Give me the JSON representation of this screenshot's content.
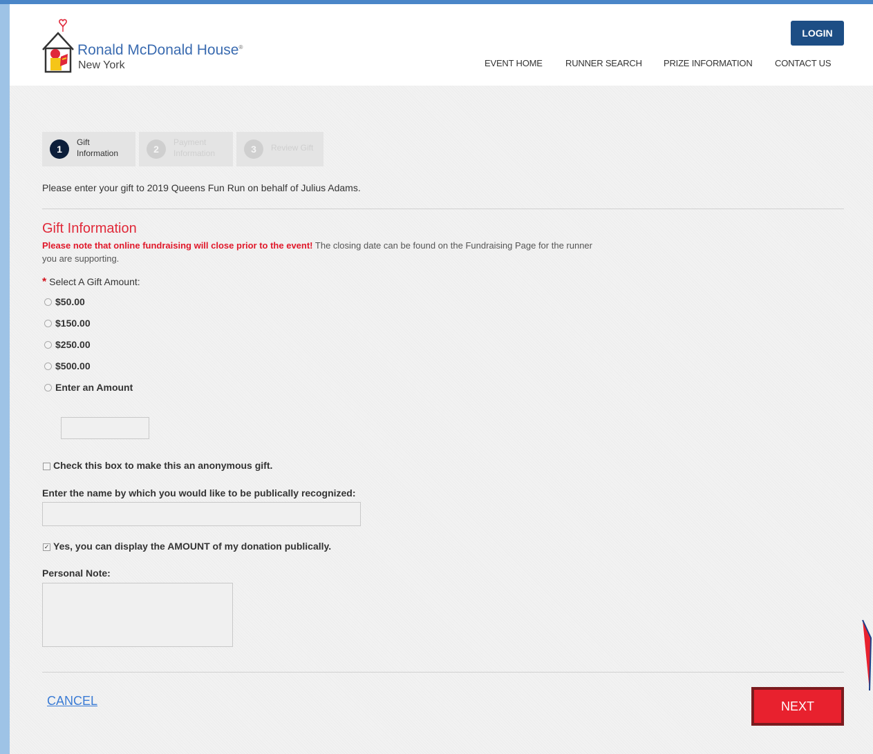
{
  "brand": {
    "name": "Ronald McDonald House",
    "registered_mark": "®",
    "location": "New York"
  },
  "header": {
    "login_label": "LOGIN",
    "nav": [
      "EVENT HOME",
      "RUNNER SEARCH",
      "PRIZE INFORMATION",
      "CONTACT US"
    ]
  },
  "steps": [
    {
      "number": "1",
      "label_line1": "Gift",
      "label_line2": "Information",
      "state": "active"
    },
    {
      "number": "2",
      "label_line1": "Payment",
      "label_line2": "Information",
      "state": "inactive"
    },
    {
      "number": "3",
      "label_line1": "Review Gift",
      "label_line2": "",
      "state": "inactive"
    }
  ],
  "intro_text": "Please enter your gift to 2019 Queens Fun Run on behalf of Julius Adams.",
  "gift_section": {
    "title": "Gift Information",
    "notice_bold": "Please note that online fundraising will close prior to the event!",
    "notice_rest": " The closing date can be found on the Fundraising Page for the runner you are supporting.",
    "required_marker": "*",
    "amount_label": "Select A Gift Amount:",
    "amount_options": [
      "$50.00",
      "$150.00",
      "$250.00",
      "$500.00",
      "Enter an Amount"
    ],
    "custom_amount_value": ""
  },
  "anonymous": {
    "label": "Check this box to make this an anonymous gift.",
    "checked": false
  },
  "recognition": {
    "label": "Enter the name by which you would like to be publically recognized:",
    "value": ""
  },
  "display_amount": {
    "label": "Yes, you can display the AMOUNT of my donation publically.",
    "checked": true
  },
  "personal_note": {
    "label": "Personal Note:",
    "value": ""
  },
  "actions": {
    "cancel_label": "CANCEL",
    "next_label": "NEXT"
  },
  "colors": {
    "accent_red": "#e8212e",
    "heading_red": "#e02838",
    "nav_blue": "#1d4e85",
    "link_blue": "#3a7bd5",
    "side_blue": "#9ec3e6"
  }
}
